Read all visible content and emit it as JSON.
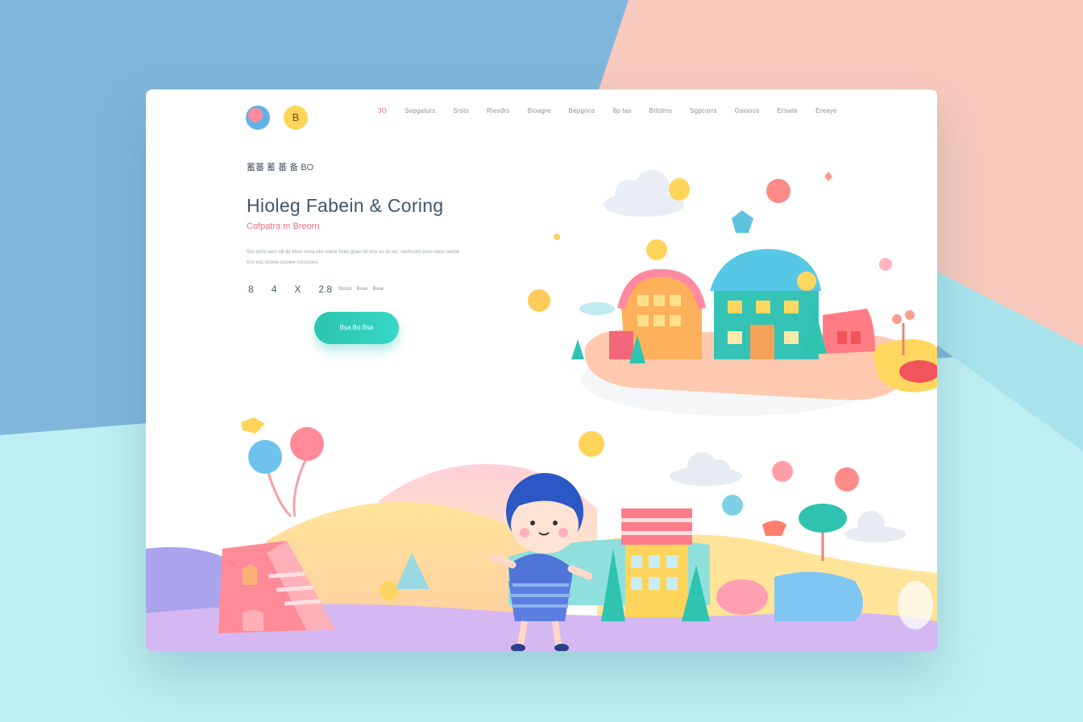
{
  "brand": {
    "logo_text": "B"
  },
  "nav": {
    "items": [
      "3O",
      "Sepgaturs",
      "Srsto",
      "Riesdrs",
      "Bioagre",
      "Bepgons",
      "8p tas",
      "Brltdms",
      "Sgpcorrs",
      "Gsiooos",
      "Erswte",
      "Ereaye"
    ]
  },
  "hero": {
    "eyebrow": "蓄蕃 蓄 蕃 备 BO",
    "title": "Hioleg Fabein & Coring",
    "subtitle": "Cofpatra m Breorn",
    "description": "Sos pero oaro o8 do bboo oooa obs wwoe bseo gsao ob doo oo do wo. oevbsoro osoo oooo oeooe oxo eoc ooooa oosoee ooosooes.",
    "stats": [
      "8",
      "4",
      "X",
      "2.8"
    ],
    "stat_small": [
      "Bssoo",
      "Bsoe",
      "Bsoe"
    ],
    "cta_label": "Bsa Bo Bsa"
  },
  "colors": {
    "teal": "#2ac6b0",
    "pink": "#ef6b7f",
    "title": "#3f5570",
    "yellow": "#ffd45a",
    "bg_blue": "#7fb6da",
    "bg_peach": "#f8c9bd",
    "bg_aqua": "#bdeef2"
  },
  "icons": [
    "logo-icon",
    "coin-icon",
    "house-icon",
    "tree-icon",
    "balloon-icon",
    "cloud-icon",
    "child-illustration"
  ]
}
